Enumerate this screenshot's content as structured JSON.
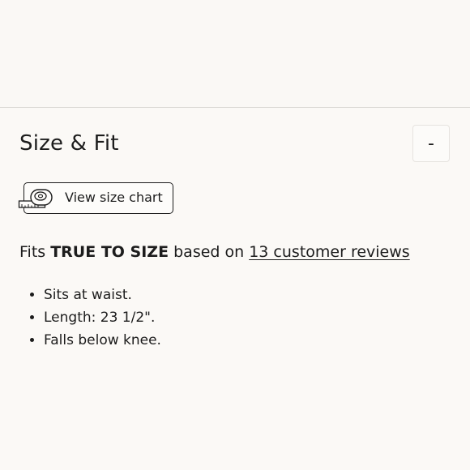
{
  "section": {
    "title": "Size & Fit",
    "collapse_label": "-"
  },
  "size_chart": {
    "label": "View size chart",
    "icon": "measuring-tape-icon"
  },
  "fit": {
    "prefix": "Fits ",
    "emphasis": "TRUE TO SIZE",
    "middle": " based on ",
    "reviews_link": "13 customer reviews"
  },
  "details": [
    "Sits at waist.",
    "Length: 23 1/2\".",
    "Falls below knee."
  ]
}
